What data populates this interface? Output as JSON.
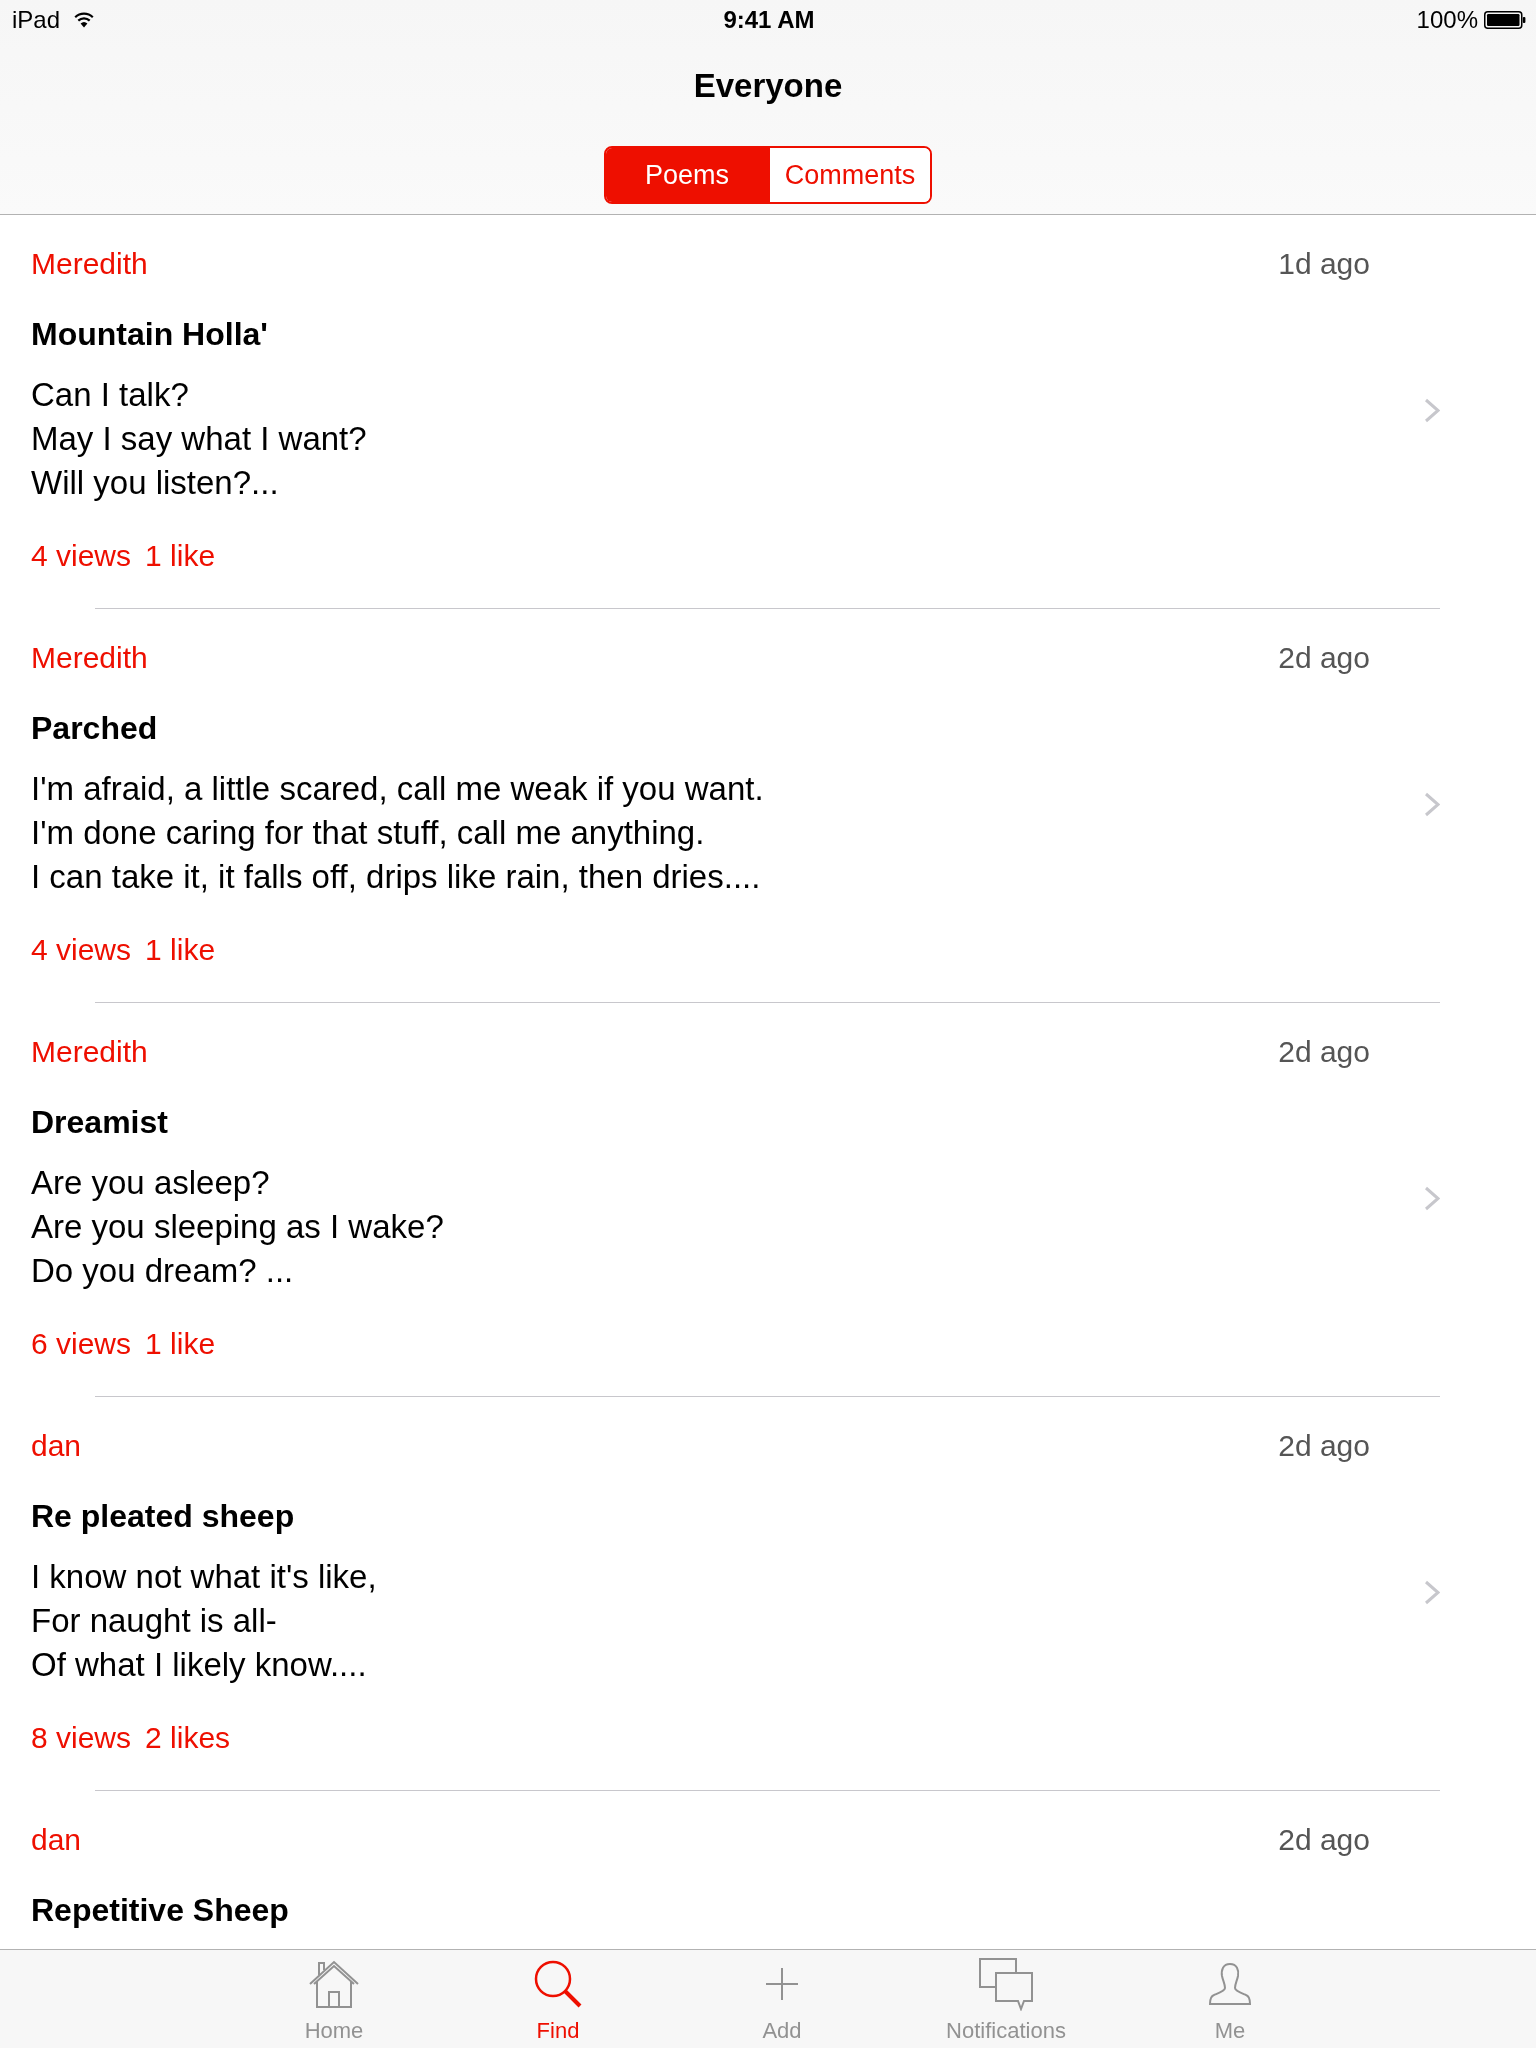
{
  "status_bar": {
    "device": "iPad",
    "time": "9:41 AM",
    "battery": "100%"
  },
  "nav_bar": {
    "title": "Everyone",
    "segments": [
      {
        "label": "Poems",
        "selected": true
      },
      {
        "label": "Comments",
        "selected": false
      }
    ]
  },
  "poems": [
    {
      "author": "Meredith",
      "time": "1d ago",
      "title": "Mountain Holla'",
      "lines": [
        "Can I talk?",
        "May I say what I want?",
        "Will you listen?..."
      ],
      "views": "4 views",
      "likes": "1 like"
    },
    {
      "author": "Meredith",
      "time": "2d ago",
      "title": "Parched",
      "lines": [
        "I'm afraid, a little scared, call me weak if you want.",
        "I'm done caring for that stuff, call me anything.",
        "I can take it, it falls off, drips like rain, then dries...."
      ],
      "views": "4 views",
      "likes": "1 like"
    },
    {
      "author": "Meredith",
      "time": "2d ago",
      "title": "Dreamist",
      "lines": [
        "Are you asleep?",
        "Are you sleeping as I wake?",
        "Do you dream? ..."
      ],
      "views": "6 views",
      "likes": "1 like"
    },
    {
      "author": "dan",
      "time": "2d ago",
      "title": "Re pleated sheep",
      "lines": [
        "I know not what it's like,",
        "For naught is all-",
        "Of what I likely know...."
      ],
      "views": "8 views",
      "likes": "2 likes"
    },
    {
      "author": "dan",
      "time": "2d ago",
      "title": "Repetitive Sheep"
    }
  ],
  "tab_bar": {
    "items": [
      {
        "kind": "home",
        "label": "Home",
        "selected": false
      },
      {
        "kind": "search",
        "label": "Find",
        "selected": true
      },
      {
        "kind": "add",
        "label": "Add",
        "selected": false
      },
      {
        "kind": "notifications",
        "label": "Notifications",
        "selected": false
      },
      {
        "kind": "profile",
        "label": "Me",
        "selected": false
      }
    ]
  }
}
